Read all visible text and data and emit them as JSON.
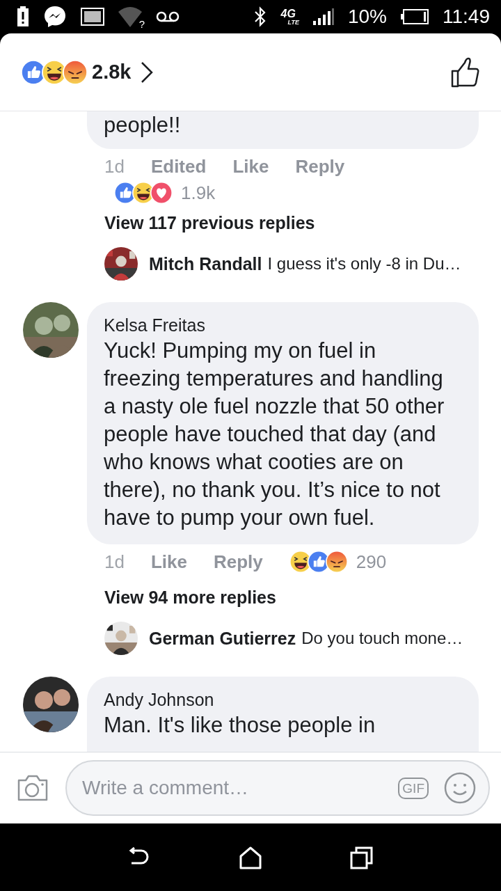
{
  "status_bar": {
    "wifi_badge": "?",
    "network": "4G",
    "network_sub": "LTE",
    "battery": "10%",
    "time": "11:49"
  },
  "header": {
    "reactions": [
      {
        "kind": "like"
      },
      {
        "kind": "haha"
      },
      {
        "kind": "angry"
      }
    ],
    "count": "2.8k"
  },
  "comments": [
    {
      "kind": "partial",
      "body": "people!!",
      "meta": [
        {
          "kind": "time",
          "label": "1d"
        },
        {
          "kind": "action",
          "label": "Edited"
        },
        {
          "kind": "action",
          "label": "Like"
        },
        {
          "kind": "action",
          "label": "Reply"
        }
      ],
      "reactions_inline": false,
      "reactions": [
        {
          "kind": "like"
        },
        {
          "kind": "haha"
        },
        {
          "kind": "love"
        }
      ],
      "reaction_count": "1.9k",
      "view_replies": "View 117 previous replies",
      "reply_preview": {
        "author": "Mitch Randall",
        "text": "I guess it's only -8 in Du…"
      }
    },
    {
      "kind": "full",
      "author": "Kelsa Freitas",
      "body": "Yuck! Pumping my on fuel in freezing temperatures and handling a nasty ole fuel nozzle that 50 other people have touched that day (and who knows what cooties are on there), no thank you. It’s nice to not have to pump your own fuel.",
      "meta": [
        {
          "kind": "time",
          "label": "1d"
        },
        {
          "kind": "action",
          "label": "Like"
        },
        {
          "kind": "action",
          "label": "Reply"
        }
      ],
      "reactions_inline": true,
      "reactions": [
        {
          "kind": "haha"
        },
        {
          "kind": "like"
        },
        {
          "kind": "angry"
        }
      ],
      "reaction_count": "290",
      "view_replies": "View 94 more replies",
      "reply_preview": {
        "author": "German Gutierrez",
        "text": "Do you touch mone…"
      }
    },
    {
      "kind": "full",
      "author": "Andy Johnson",
      "body": "Man. It's like those people in"
    }
  ],
  "composer": {
    "placeholder": "Write a comment…",
    "gif": "GIF"
  }
}
